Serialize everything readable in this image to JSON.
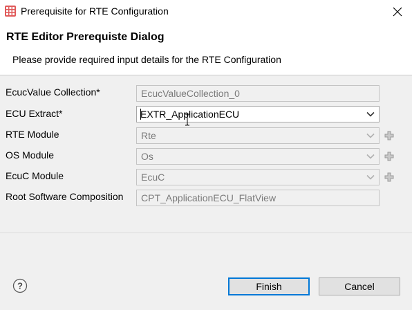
{
  "window": {
    "title": "Prerequisite for RTE Configuration",
    "app_icon": "grid-app-icon",
    "close_icon": "close-icon"
  },
  "header": {
    "title": "RTE Editor Prerequiste Dialog",
    "message": "Please provide required input details for the RTE Configuration"
  },
  "form": {
    "ecuc_value_collection": {
      "label": "EcucValue Collection*",
      "value": "EcucValueCollection_0"
    },
    "ecu_extract": {
      "label": "ECU Extract*",
      "value": "EXTR_ApplicationECU"
    },
    "rte_module": {
      "label": "RTE Module",
      "value": "Rte"
    },
    "os_module": {
      "label": "OS Module",
      "value": "Os"
    },
    "ecuc_module": {
      "label": "EcuC Module",
      "value": "EcuC"
    },
    "root_composition": {
      "label": "Root Software Composition",
      "value": "CPT_ApplicationECU_FlatView"
    }
  },
  "buttons": {
    "finish": "Finish",
    "cancel": "Cancel",
    "help_icon": "help-icon"
  },
  "colors": {
    "default_button_border": "#0078d7",
    "disabled_text": "#7a7a7a",
    "app_icon": "#d9534f"
  }
}
